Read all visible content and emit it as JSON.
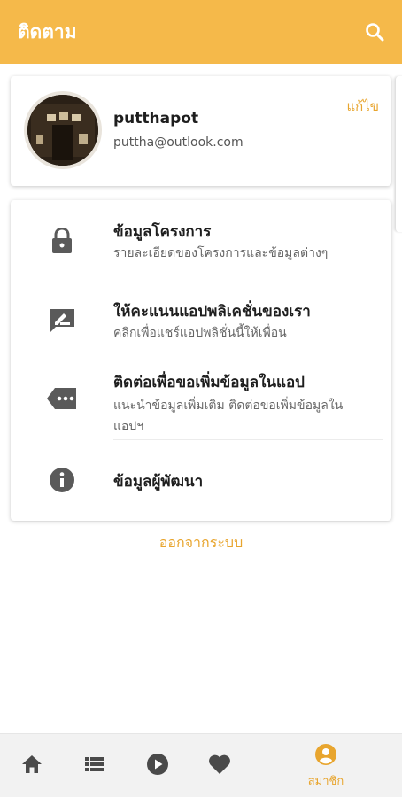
{
  "appbar": {
    "title": "ติดตาม",
    "search_icon": "search-icon",
    "background": "#f5b94a"
  },
  "profile": {
    "name": "putthapot",
    "email": "puttha@outlook.com",
    "edit_label": "แก้ไข",
    "avatar_icon": "avatar-photo"
  },
  "menu": [
    {
      "icon": "lock-icon",
      "title": "ข้อมูลโครงการ",
      "subtitle": "รายละเอียดของโครงการและข้อมูลต่างๆ"
    },
    {
      "icon": "rate-edit-icon",
      "title": "ให้คะแนนแอปพลิเคชั่นของเรา",
      "subtitle": "คลิกเพื่อแชร์แอปพลิชั่นนี้ให้เพื่อน"
    },
    {
      "icon": "message-tag-icon",
      "title": "ติดต่อเพื่อขอเพิ่มข้อมูลในแอป",
      "subtitle": "แนะนำข้อมูลเพิ่มเติม ติดต่อขอเพิ่มข้อมูลในแอปฯ"
    },
    {
      "icon": "info-icon",
      "title": "ข้อมูลผู้พัฒนา",
      "subtitle": ""
    }
  ],
  "logout_label": "ออกจากระบบ",
  "bottom_nav": {
    "items": [
      {
        "icon": "home-icon",
        "label": ""
      },
      {
        "icon": "list-icon",
        "label": ""
      },
      {
        "icon": "play-icon",
        "label": ""
      },
      {
        "icon": "heart-icon",
        "label": ""
      },
      {
        "icon": "account-icon",
        "label": "สมาชิก",
        "active": true
      }
    ]
  },
  "colors": {
    "accent": "#f5b94a",
    "accent_text": "#e8a52e",
    "icon_gray": "#5a5a5a",
    "nav_icon": "#4a4a4a"
  }
}
